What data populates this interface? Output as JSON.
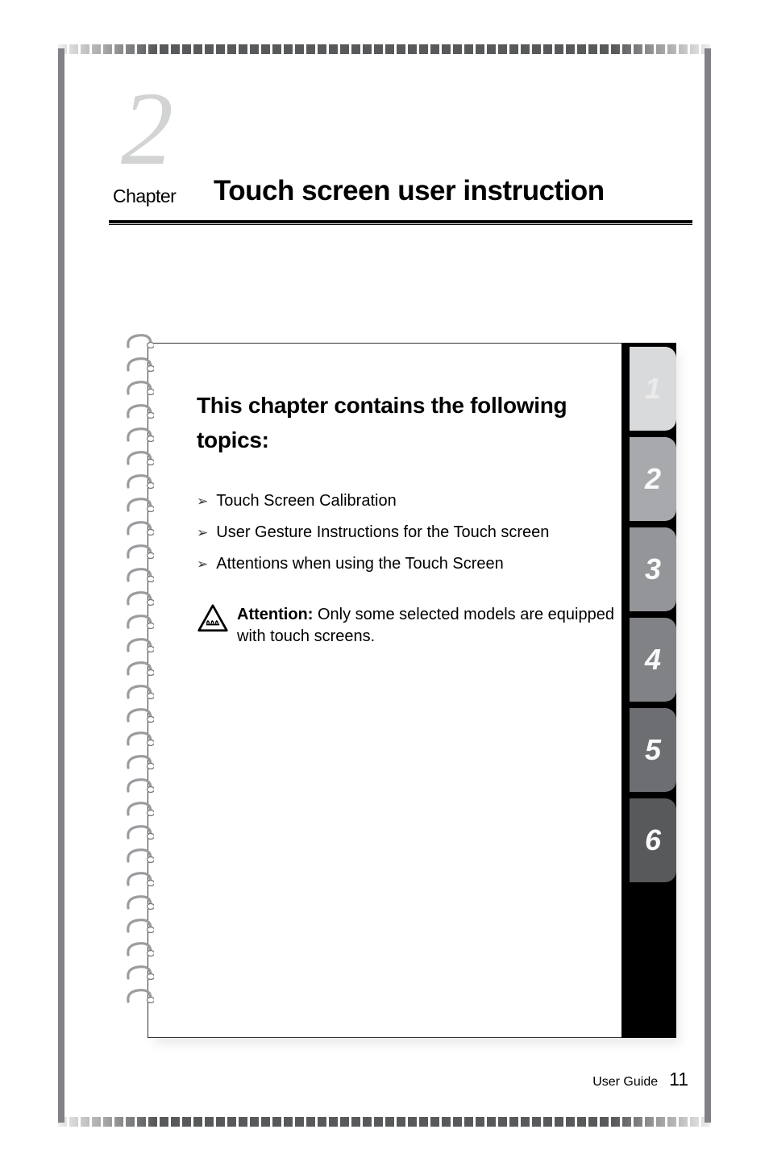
{
  "chapter": {
    "big_number": "2",
    "label": "Chapter",
    "title": "Touch screen user instruction"
  },
  "topics": {
    "heading": "This chapter contains the following topics:",
    "items": [
      "Touch Screen Calibration",
      "User Gesture Instructions for the Touch screen",
      "Attentions when using the Touch Screen"
    ]
  },
  "attention": {
    "label": "Attention:",
    "text": " Only some selected models are equipped with touch screens."
  },
  "tabs": {
    "t1": "1",
    "t2": "2",
    "t3": "3",
    "t4": "4",
    "t5": "5",
    "t6": "6"
  },
  "footer": {
    "label": "User Guide",
    "page_number": "11"
  }
}
